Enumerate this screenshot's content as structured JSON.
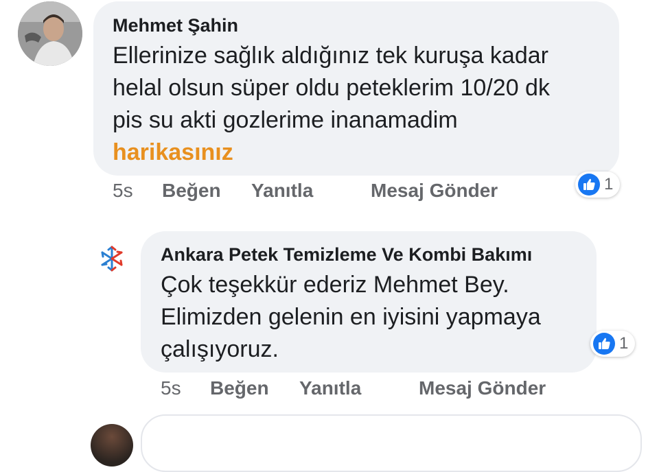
{
  "comments": [
    {
      "author": "Mehmet Şahin",
      "lines": [
        "Ellerinize sağlık aldığınız tek kuruşa kadar",
        "helal olsun süper oldu peteklerim 10/20 dk",
        "pis su akti gozlerime inanamadim"
      ],
      "highlight": "harikasınız",
      "time": "5s",
      "like_label": "Beğen",
      "reply_label": "Yanıtla",
      "message_label": "Mesaj Gönder",
      "reaction_count": "1",
      "reaction_icon": "like-icon",
      "accent_color": "#e8901f"
    },
    {
      "author": "Ankara Petek Temizleme Ve Kombi Bakımı",
      "lines": [
        "Çok teşekkür ederiz Mehmet Bey.",
        "Elimizden gelenin en iyisini yapmaya",
        "çalışıyoruz."
      ],
      "time": "5s",
      "like_label": "Beğen",
      "reply_label": "Yanıtla",
      "message_label": "Mesaj Gönder",
      "reaction_count": "1",
      "reaction_icon": "like-icon"
    }
  ],
  "colors": {
    "bubble": "#f0f2f5",
    "like_blue": "#1877f2",
    "meta_gray": "#65676b"
  }
}
